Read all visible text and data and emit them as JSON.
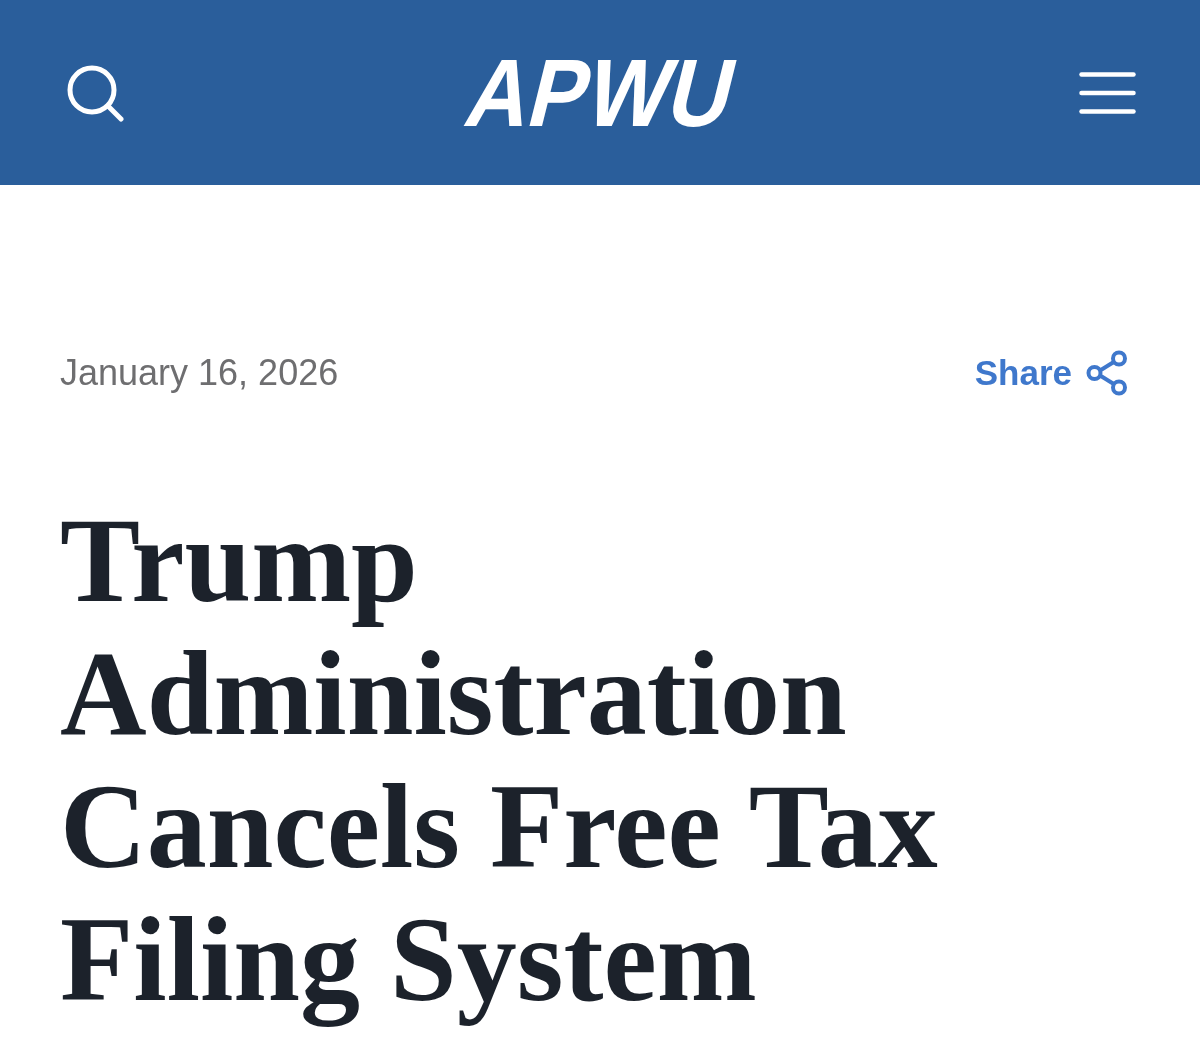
{
  "header": {
    "logo": "APWU"
  },
  "article": {
    "date": "January 16, 2026",
    "share_label": "Share",
    "title": "Trump Administration Cancels Free Tax Filing System"
  }
}
